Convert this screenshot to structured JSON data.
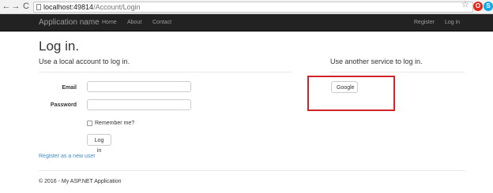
{
  "browser": {
    "url_host": "localhost:49814",
    "url_path": "/Account/Login",
    "back_glyph": "←",
    "forward_glyph": "→",
    "reload_glyph": "C",
    "star_glyph": "☆",
    "ext1_glyph": "O",
    "ext2_glyph": "S",
    "ext1_color": "#e0281d",
    "ext2_color": "#13a9e5"
  },
  "navbar": {
    "brand": "Application name",
    "links": [
      "Home",
      "About",
      "Contact"
    ],
    "right_links": [
      "Register",
      "Log in"
    ],
    "background": "#222222"
  },
  "page": {
    "title": "Log in.",
    "local_heading": "Use a local account to log in.",
    "external_heading": "Use another service to log in.",
    "email_label": "Email",
    "password_label": "Password",
    "email_value": "",
    "password_value": "",
    "remember_label": "Remember me?",
    "login_button": "Log in",
    "register_link": "Register as a new user",
    "google_button": "Google",
    "highlight_color": "#d2232a"
  },
  "footer": {
    "text": "© 2016 - My ASP.NET Application"
  }
}
